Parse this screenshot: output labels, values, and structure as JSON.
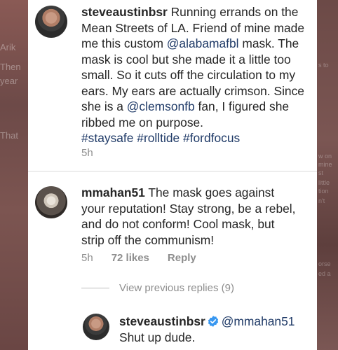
{
  "background": {
    "left_ghost": [
      "Arik",
      "Then",
      "year",
      "That"
    ],
    "right_ghost": [
      "s to",
      "w on",
      "mine",
      "st",
      "little",
      "tion",
      "n't",
      "orse",
      "ed a"
    ]
  },
  "post": {
    "username": "steveaustinbsr",
    "caption_lines": [
      {
        "pre": "Running errands on the",
        "mention": "",
        "post": ""
      },
      {
        "pre": "Mean Streets of LA. Friend of mine made",
        "mention": "",
        "post": ""
      },
      {
        "pre": "me this custom ",
        "mention": "@alabamafbl",
        "post": " mask. The"
      },
      {
        "pre": "mask is cool but she made it a little too",
        "mention": "",
        "post": ""
      },
      {
        "pre": "small. So it cuts off the circulation to my",
        "mention": "",
        "post": ""
      },
      {
        "pre": "ears. My ears are actually crimson. Since",
        "mention": "",
        "post": ""
      },
      {
        "pre": "she is a ",
        "mention": "@clemsonfb",
        "post": " fan, I figured she"
      },
      {
        "pre": "ribbed me on purpose.",
        "mention": "",
        "post": ""
      }
    ],
    "hashtags": "#staysafe #rolltide #fordfocus",
    "time": "5h"
  },
  "comment": {
    "username": "mmahan51",
    "lines": [
      "The mask goes against",
      "your reputation!  Stay strong, be a rebel,",
      "and do not conform!  Cool mask, but",
      "strip off the communism!"
    ],
    "time": "5h",
    "likes": "72 likes",
    "reply_label": "Reply"
  },
  "view_replies": "View previous replies (9)",
  "reply": {
    "username": "steveaustinbsr",
    "mention": "@mmahan51",
    "text": "Shut up dude."
  },
  "colors": {
    "text": "#262626",
    "muted": "#8e8e8e",
    "mention": "#1f3a67",
    "verified": "#3897f0"
  }
}
